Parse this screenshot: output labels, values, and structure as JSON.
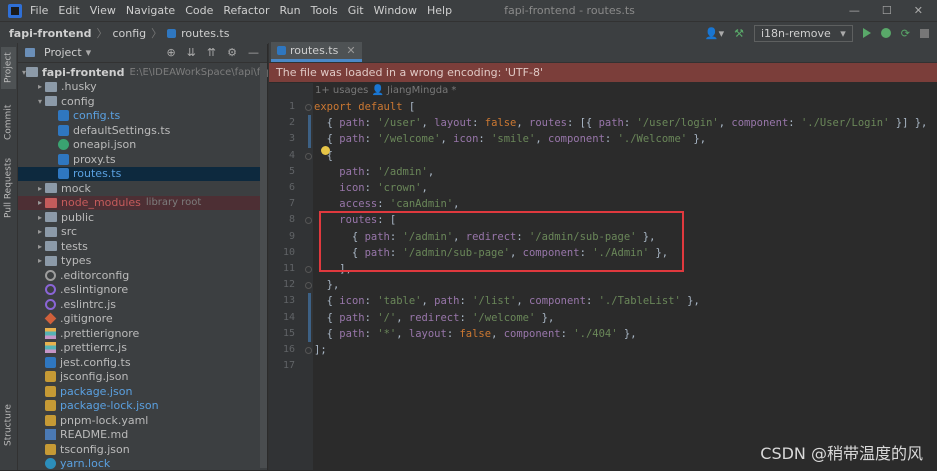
{
  "menubar": {
    "items": [
      "File",
      "Edit",
      "View",
      "Navigate",
      "Code",
      "Refactor",
      "Run",
      "Tools",
      "Git",
      "Window",
      "Help"
    ],
    "title": "fapi-frontend - routes.ts"
  },
  "navbar": {
    "crumbs": [
      "fapi-frontend",
      "config",
      "routes.ts"
    ],
    "run_config": "i18n-remove"
  },
  "leftstrip": [
    "Project",
    "Commit",
    "Pull Requests",
    "Structure"
  ],
  "project": {
    "title": "Project",
    "root": {
      "name": "fapi-frontend",
      "path": "E:\\E\\IDEAWorkSpace\\fapi\\fapi-fronte"
    },
    "rows": [
      {
        "name": ".husky",
        "type": "folder",
        "indent": 2,
        "collapsed": true
      },
      {
        "name": "config",
        "type": "folder",
        "indent": 2,
        "collapsed": false
      },
      {
        "name": "config.ts",
        "type": "ts",
        "indent": 3,
        "blue": true
      },
      {
        "name": "defaultSettings.ts",
        "type": "ts",
        "indent": 3
      },
      {
        "name": "oneapi.json",
        "type": "oneapi",
        "indent": 3
      },
      {
        "name": "proxy.ts",
        "type": "ts",
        "indent": 3
      },
      {
        "name": "routes.ts",
        "type": "ts",
        "indent": 3,
        "blue": true,
        "selected": true
      },
      {
        "name": "mock",
        "type": "folder",
        "indent": 2,
        "collapsed": true
      },
      {
        "name": "node_modules",
        "meta": "library root",
        "type": "folder-red",
        "indent": 2,
        "collapsed": true,
        "excluded": true
      },
      {
        "name": "public",
        "type": "folder",
        "indent": 2,
        "collapsed": true
      },
      {
        "name": "src",
        "type": "folder",
        "indent": 2,
        "collapsed": true
      },
      {
        "name": "tests",
        "type": "folder",
        "indent": 2,
        "collapsed": true
      },
      {
        "name": "types",
        "type": "folder",
        "indent": 2,
        "collapsed": true
      },
      {
        "name": ".editorconfig",
        "type": "cfg",
        "indent": 2
      },
      {
        "name": ".eslintignore",
        "type": "ring",
        "indent": 2
      },
      {
        "name": ".eslintrc.js",
        "type": "ring",
        "indent": 2
      },
      {
        "name": ".gitignore",
        "type": "git",
        "indent": 2
      },
      {
        "name": ".prettierignore",
        "type": "pretty",
        "indent": 2
      },
      {
        "name": ".prettierrc.js",
        "type": "pretty",
        "indent": 2
      },
      {
        "name": "jest.config.ts",
        "type": "ts",
        "indent": 2
      },
      {
        "name": "jsconfig.json",
        "type": "json",
        "indent": 2
      },
      {
        "name": "package.json",
        "type": "json",
        "indent": 2,
        "blue": true
      },
      {
        "name": "package-lock.json",
        "type": "json",
        "indent": 2,
        "blue": true
      },
      {
        "name": "pnpm-lock.yaml",
        "type": "json",
        "indent": 2
      },
      {
        "name": "README.md",
        "type": "md",
        "indent": 2
      },
      {
        "name": "tsconfig.json",
        "type": "json",
        "indent": 2
      },
      {
        "name": "yarn.lock",
        "type": "yarn",
        "indent": 2,
        "blue": true
      }
    ]
  },
  "editor": {
    "tab": "routes.ts",
    "warning": "The file was loaded in a wrong encoding: 'UTF-8'",
    "usage_hint": "1+ usages  👤 JiangMingda *",
    "lines": [
      "export default [",
      "  { path: '/user', layout: false, routes: [{ path: '/user/login', component: './User/Login' }] },",
      "  { path: '/welcome', icon: 'smile', component: './Welcome' },",
      "  {",
      "    path: '/admin',",
      "    icon: 'crown',",
      "    access: 'canAdmin',",
      "    routes: [",
      "      { path: '/admin', redirect: '/admin/sub-page' },",
      "      { path: '/admin/sub-page', component: './Admin' },",
      "    ],",
      "  },",
      "  { icon: 'table', path: '/list', component: './TableList' },",
      "  { path: '/', redirect: '/welcome' },",
      "  { path: '*', layout: false, component: './404' },",
      "];",
      ""
    ]
  },
  "watermark": "CSDN @稍带温度的风"
}
